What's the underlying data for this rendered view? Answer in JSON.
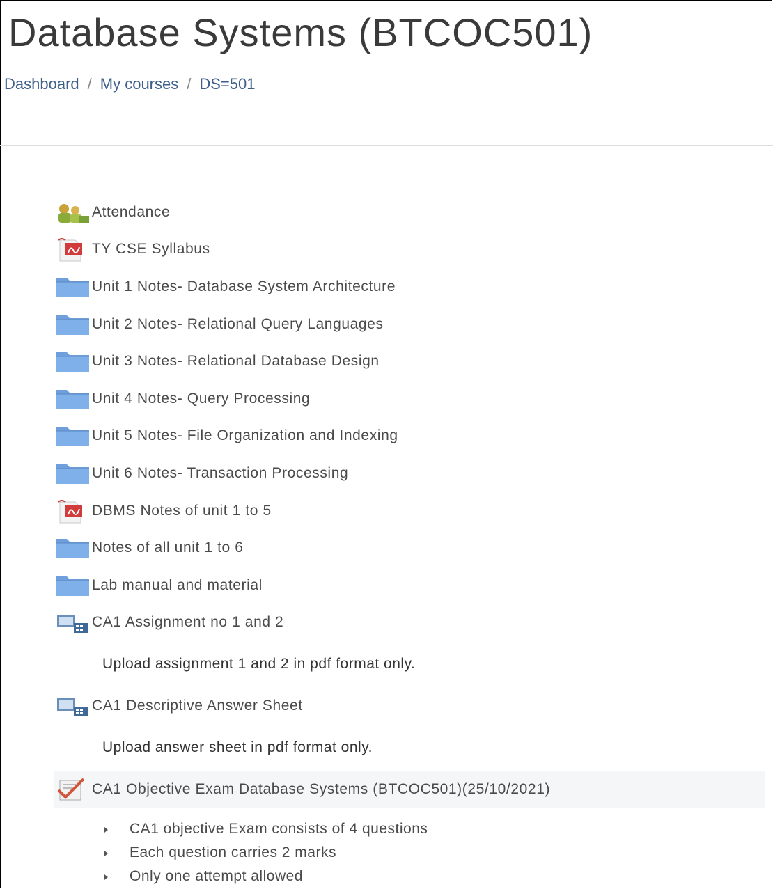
{
  "page": {
    "title": "Database Systems (BTCOC501)"
  },
  "breadcrumb": {
    "items": [
      "Dashboard",
      "My courses",
      "DS=501"
    ],
    "separator": "/"
  },
  "colors": {
    "folder": "#6f9fdc",
    "pdf": "#d23b3b",
    "attendance": "#8aaa3a",
    "link": "#3e5f8a",
    "text": "#4a4a4a"
  },
  "activities": [
    {
      "label": "Attendance",
      "icon": "attendance-icon"
    },
    {
      "label": "TY CSE Syllabus",
      "icon": "pdf-icon"
    },
    {
      "label": "Unit 1 Notes- Database System Architecture",
      "icon": "folder-icon"
    },
    {
      "label": "Unit 2 Notes- Relational Query Languages",
      "icon": "folder-icon"
    },
    {
      "label": "Unit 3 Notes- Relational Database Design",
      "icon": "folder-icon"
    },
    {
      "label": "Unit 4 Notes- Query Processing",
      "icon": "folder-icon"
    },
    {
      "label": "Unit 5 Notes- File Organization and Indexing",
      "icon": "folder-icon"
    },
    {
      "label": "Unit 6 Notes- Transaction Processing",
      "icon": "folder-icon"
    },
    {
      "label": "DBMS Notes of unit 1 to 5",
      "icon": "pdf-icon"
    },
    {
      "label": "Notes of all unit 1 to 6",
      "icon": "folder-icon"
    },
    {
      "label": "Lab manual and material",
      "icon": "folder-icon"
    },
    {
      "label": "CA1 Assignment no 1 and 2",
      "icon": "assignment-icon"
    }
  ],
  "assignment1": {
    "description": "Upload assignment 1 and 2 in pdf format only."
  },
  "assignment2": {
    "label": "CA1 Descriptive Answer Sheet",
    "icon": "assignment-icon",
    "description": "Upload answer sheet in pdf format only."
  },
  "quiz": {
    "label": "CA1 Objective Exam Database Systems (BTCOC501)(25/10/2021)",
    "icon": "quiz-icon",
    "bullets": [
      "CA1 objective Exam consists of 4 questions",
      "Each question carries 2 marks",
      "Only one attempt allowed"
    ]
  }
}
